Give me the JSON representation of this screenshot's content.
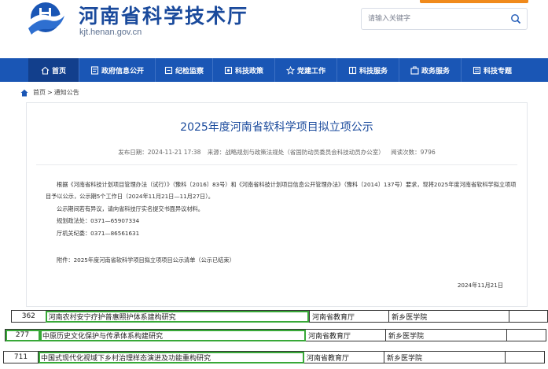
{
  "header": {
    "site_title": "河南省科学技术厅",
    "site_url": "kjt.henan.gov.cn",
    "emblem_icon": "henan-logo-icon",
    "search": {
      "placeholder": "请输入关键字",
      "icon": "search-icon"
    }
  },
  "nav": {
    "items": [
      {
        "label": "首页",
        "icon": "home-icon",
        "active": true
      },
      {
        "label": "政府信息公开",
        "icon": "document-icon"
      },
      {
        "label": "纪检监察",
        "icon": "shield-icon"
      },
      {
        "label": "科技政策",
        "icon": "policy-icon"
      },
      {
        "label": "党建工作",
        "icon": "star-icon"
      },
      {
        "label": "科技服务",
        "icon": "service-icon"
      },
      {
        "label": "政务服务",
        "icon": "briefcase-icon"
      },
      {
        "label": "科技专题",
        "icon": "topic-icon"
      }
    ]
  },
  "breadcrumb": {
    "home": "首页",
    "separator": ">",
    "current": "通知公告"
  },
  "article": {
    "title": "2025年度河南省软科学项目拟立项公示",
    "meta": {
      "published": "发布日期：2024-11-21 17:38",
      "source": "来源：战略规划与政策法规处（省国防动员委员会科技动员办公室）",
      "views": "阅读次数：9796"
    },
    "paragraphs": [
      "根据《河南省科技计划项目管理办法（试行）》（豫科〔2016〕83号）和《河南省科技计划项目信息公开管理办法》（豫科〔2014〕137号）要求，现将2025年度河南省软科学拟立项项目予以公示，公示期5个工作日（2024年11月21日—11月27日）。",
      "公示期间若有异议，请向省科技厅实名提交书面异议材料。",
      "规划政法处：0371—65907334",
      "厅机关纪委：0371—86561631"
    ],
    "attachment": "附件：2025年度河南省软科学项目拟立项项目公示清单（公示已结束）",
    "date": "2024年11月21日"
  },
  "table": {
    "rows": [
      {
        "num": "362",
        "name": "河南农村安宁疗护普惠照护体系建构研究",
        "dept": "河南省教育厅",
        "unit": "新乡医学院"
      },
      {
        "num": "277",
        "name": "中原历史文化保护与传承体系构建研究",
        "dept": "河南省教育厅",
        "unit": "新乡医学院"
      },
      {
        "num": "711",
        "name": "中国式现代化视域下乡村治理样态演进及功能重构研究",
        "dept": "河南省教育厅",
        "unit": "新乡医学院"
      }
    ]
  },
  "colors": {
    "brand_blue": "#1a56b5",
    "nav_active": "#123f8c",
    "title_blue": "#1a4a9c",
    "accent_orange": "#f08a1c",
    "highlight_green": "#38a838"
  }
}
